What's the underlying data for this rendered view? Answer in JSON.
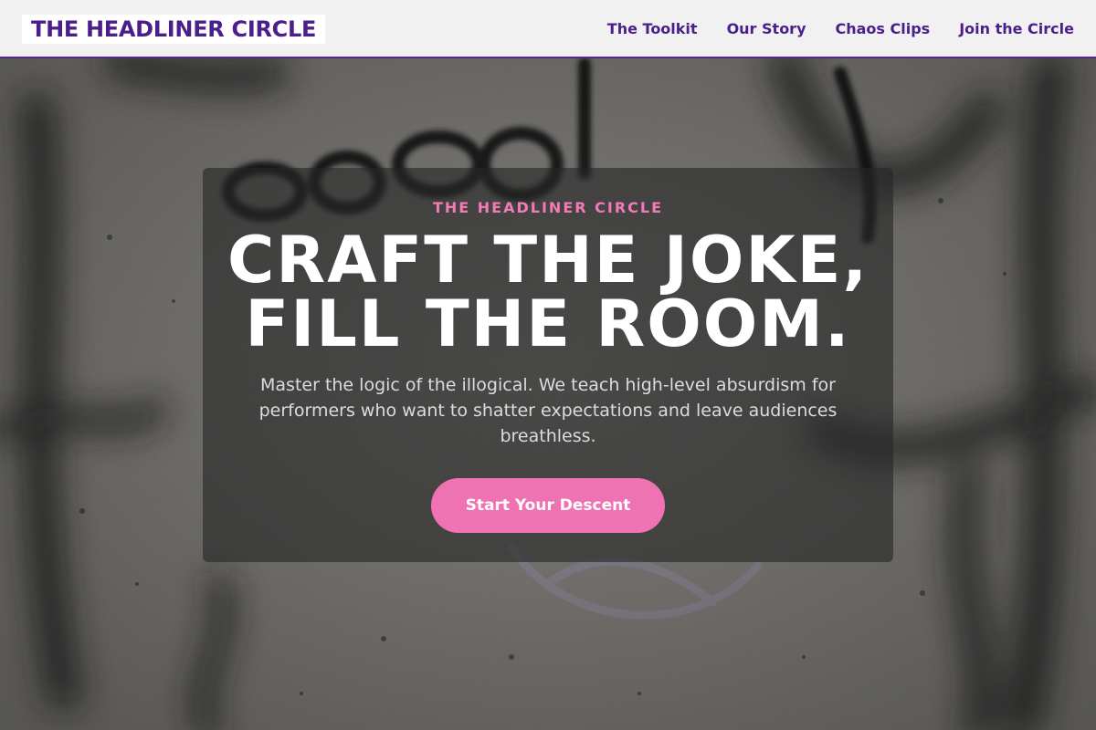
{
  "header": {
    "logo": "THE HEADLINER CIRCLE",
    "nav": [
      {
        "label": "The Toolkit"
      },
      {
        "label": "Our Story"
      },
      {
        "label": "Chaos Clips"
      },
      {
        "label": "Join the Circle"
      }
    ]
  },
  "hero": {
    "background_image": "concrete wall with black graffiti",
    "eyebrow": "THE HEADLINER CIRCLE",
    "headline_line1": "CRAFT THE JOKE,",
    "headline_line2": "FILL THE ROOM.",
    "subtext": "Master the logic of the illogical. We teach high-level absurdism for performers who want to shatter expectations and leave audiences breathless.",
    "cta_label": "Start Your Descent"
  },
  "colors": {
    "brand_purple": "#4a1f8c",
    "accent_pink": "#ef72b3",
    "eyebrow_pink": "#f27ab8",
    "header_bg": "#f1f1f2"
  }
}
